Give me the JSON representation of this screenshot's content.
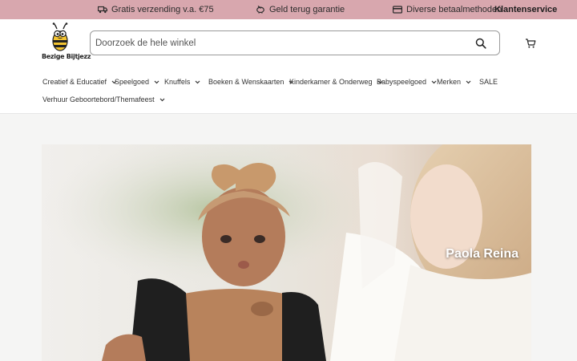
{
  "topbar": {
    "usps": [
      {
        "label": "Gratis verzending v.a. €75",
        "icon": "truck-icon"
      },
      {
        "label": "Geld terug garantie",
        "icon": "piggy-bank-icon"
      },
      {
        "label": "Diverse betaalmethoden",
        "icon": "credit-card-icon"
      }
    ],
    "service_label": "Klantenservice"
  },
  "header": {
    "logo_text": "Bezige Bijtjezz",
    "search": {
      "placeholder": "Doorzoek de hele winkel"
    },
    "nav": [
      {
        "label": "Creatief & Educatief",
        "has_dropdown": true
      },
      {
        "label": "Speelgoed",
        "has_dropdown": true
      },
      {
        "label": "Knuffels",
        "has_dropdown": true
      },
      {
        "label": "Boeken & Wenskaarten",
        "has_dropdown": true
      },
      {
        "label": "Kinderkamer & Onderweg",
        "has_dropdown": true
      },
      {
        "label": "Babyspeelgoed",
        "has_dropdown": true
      },
      {
        "label": "Merken",
        "has_dropdown": true
      },
      {
        "label": "SALE",
        "has_dropdown": false
      },
      {
        "label": "Verhuur Geboortebord/Themafeest",
        "has_dropdown": true
      }
    ]
  },
  "hero": {
    "caption": "Paola Reina"
  },
  "colors": {
    "topbar_bg": "#d8a7ae",
    "page_bg": "#f5f5f4",
    "header_bg": "#ffffff"
  }
}
